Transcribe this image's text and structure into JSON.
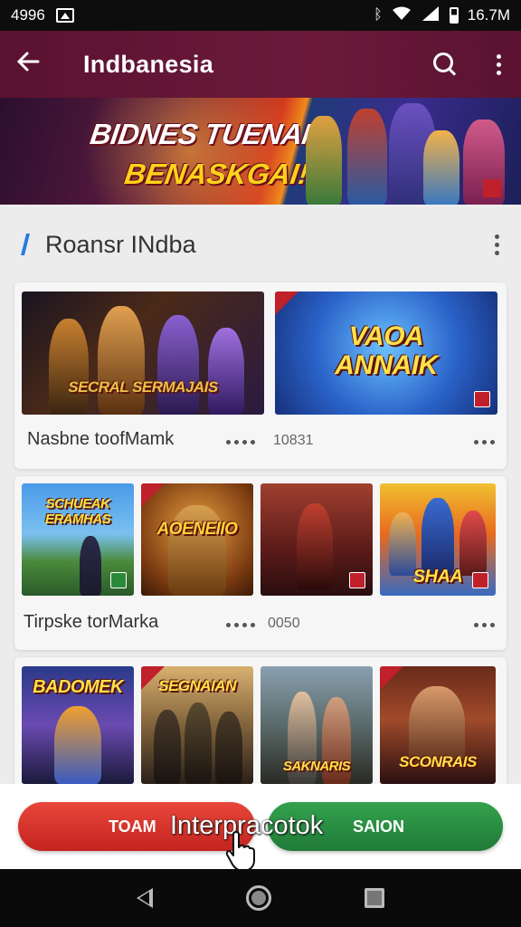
{
  "status_bar": {
    "left_text": "4996",
    "time": "16.7M",
    "icons": [
      "image-icon",
      "bluetooth-icon",
      "wifi-icon",
      "signal-icon",
      "battery-icon"
    ]
  },
  "app_bar": {
    "title": "Indbanesia",
    "icons": [
      "back-arrow-icon",
      "search-icon",
      "more-vert-icon"
    ]
  },
  "banner": {
    "line1": "BIDNES TUENANL",
    "line2": "BENASKGAI!"
  },
  "section": {
    "title": "Roansr INdba"
  },
  "cards": {
    "row1": [
      {
        "caption": "SECRAL SERMAJAIS"
      },
      {
        "caption": "VAOA ANNAIK"
      }
    ],
    "row1_title": "Nasbne toofMamk",
    "row1_meta": "10831",
    "row2": [
      {
        "caption": "SCHUEAK ERAMHAS"
      },
      {
        "caption": "AOENEIIO"
      },
      {
        "caption": ""
      },
      {
        "caption": "SHAA"
      }
    ],
    "row2_title": "Tirpske torMarka",
    "row2_meta": "0050",
    "row3": [
      {
        "caption": "BADOMEK"
      },
      {
        "caption": "SEGNAIAN"
      },
      {
        "caption": "SAKNARIS"
      },
      {
        "caption": "SCONRAIS"
      }
    ]
  },
  "actions": {
    "left_button": "TOAM",
    "right_button": "SAION",
    "overlay_text": "Interpracotok"
  },
  "nav_bar": {
    "icons": [
      "nav-back-icon",
      "nav-home-icon",
      "nav-recents-icon"
    ]
  },
  "colors": {
    "app_bar": "#6b1a3a",
    "accent_blue": "#2a7be0",
    "button_red": "#d6322a",
    "button_green": "#2b8f45"
  }
}
